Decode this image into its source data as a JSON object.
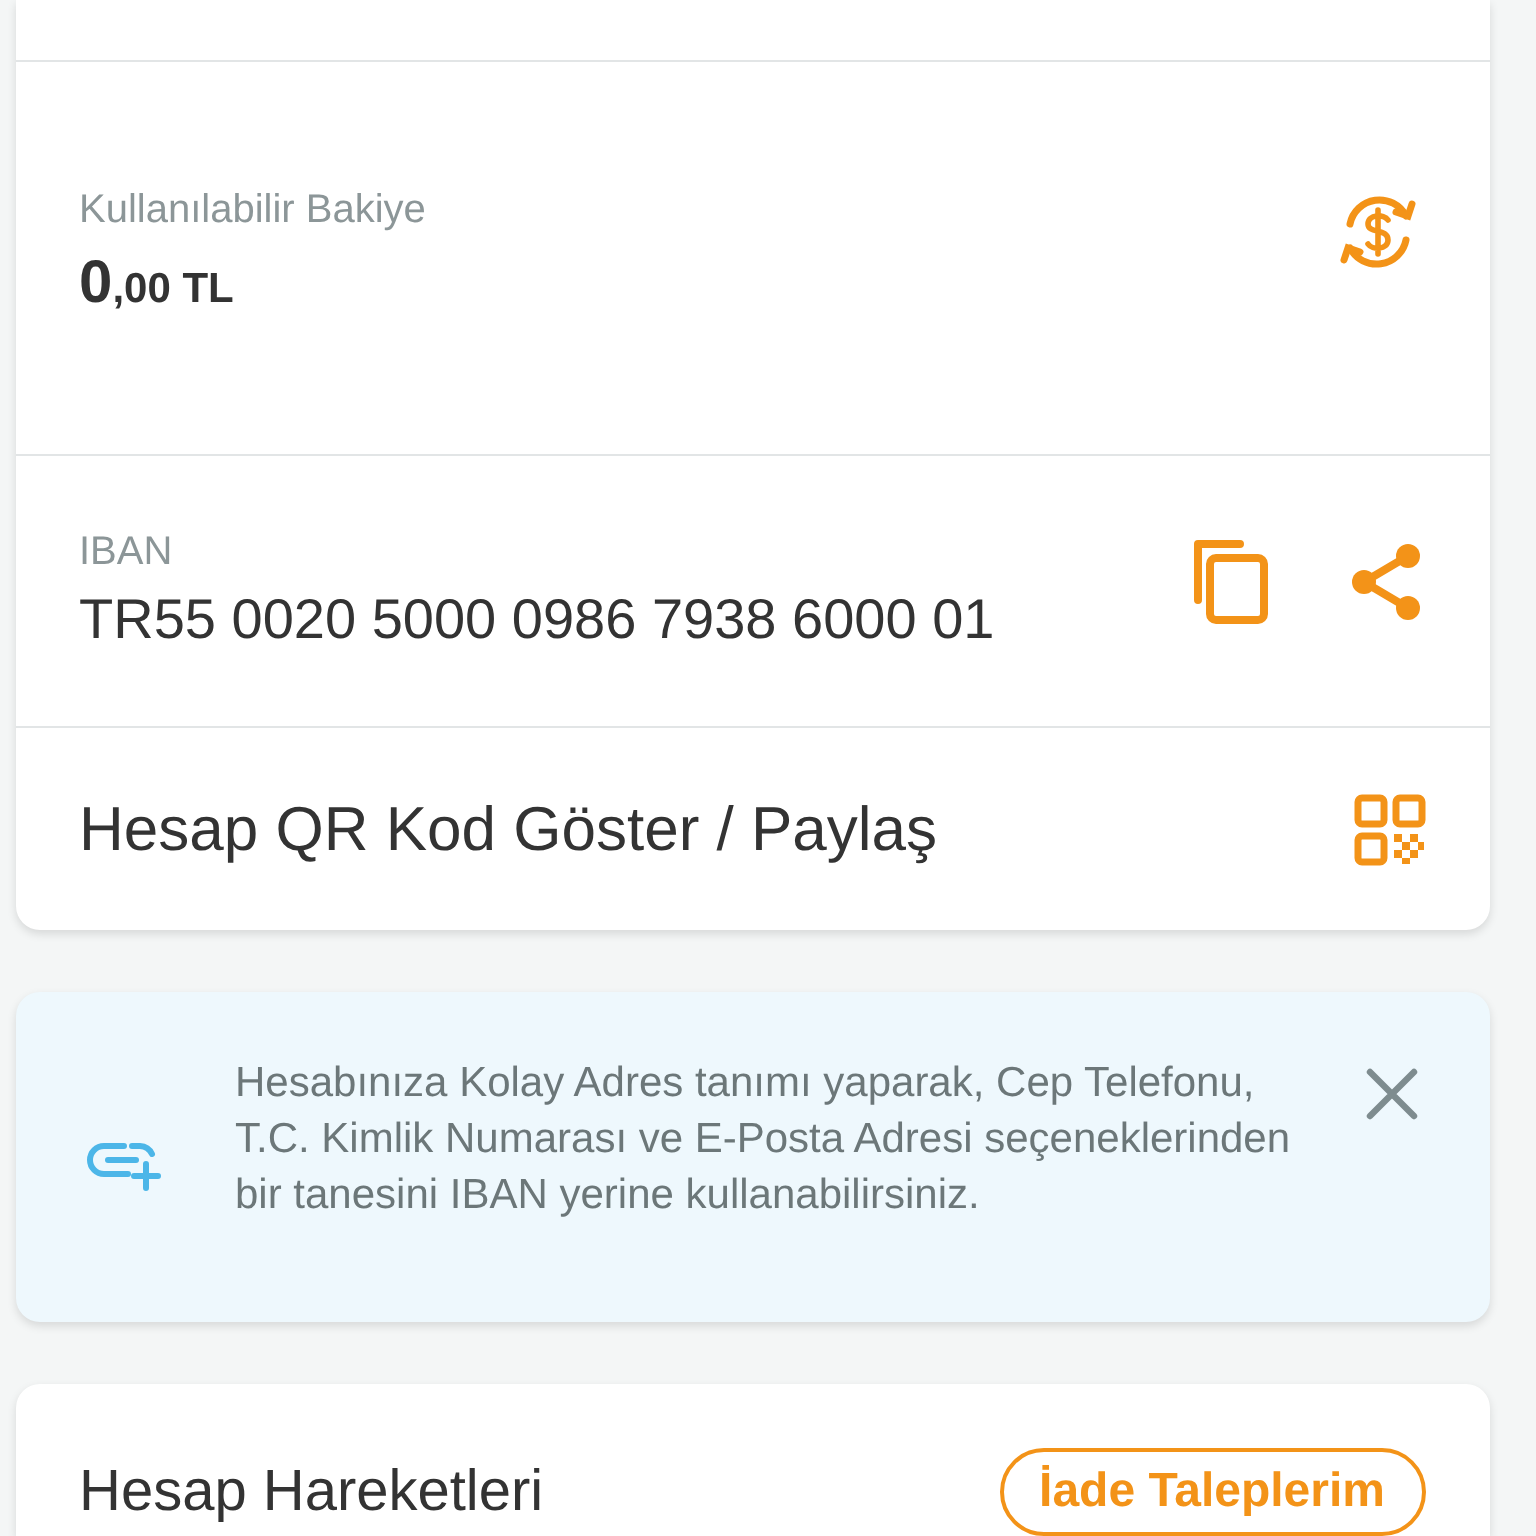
{
  "balance": {
    "label": "Kullanılabilir Bakiye",
    "amount_main": "0",
    "amount_rest": ",00 TL"
  },
  "iban": {
    "label": "IBAN",
    "value": "TR55 0020 5000 0986 7938 6000 01"
  },
  "qr_row": {
    "label": "Hesap QR Kod Göster / Paylaş"
  },
  "info_banner": {
    "text": "Hesabınıza Kolay Adres tanımı yaparak, Cep Telefonu, T.C. Kimlik Numarası ve E-Posta Adresi seçeneklerinden bir tanesini IBAN yerine kullanabilirsiniz."
  },
  "transactions": {
    "title": "Hesap Hareketleri",
    "button": "İade Taleplerim"
  }
}
